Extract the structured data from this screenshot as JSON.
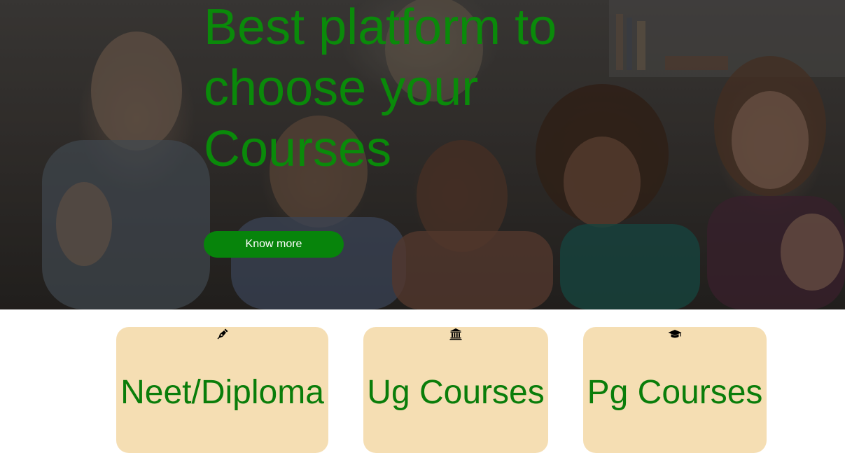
{
  "hero": {
    "title": "Best platform to choose your Courses",
    "button_label": "Know more"
  },
  "courses": [
    {
      "title": "Neet/Diploma",
      "icon": "pen-nib-icon"
    },
    {
      "title": "Ug Courses",
      "icon": "university-icon"
    },
    {
      "title": "Pg Courses",
      "icon": "graduation-cap-icon"
    }
  ],
  "colors": {
    "accent_green": "#07840b",
    "title_green": "#0a8a0a",
    "card_background": "#f5deb3"
  }
}
